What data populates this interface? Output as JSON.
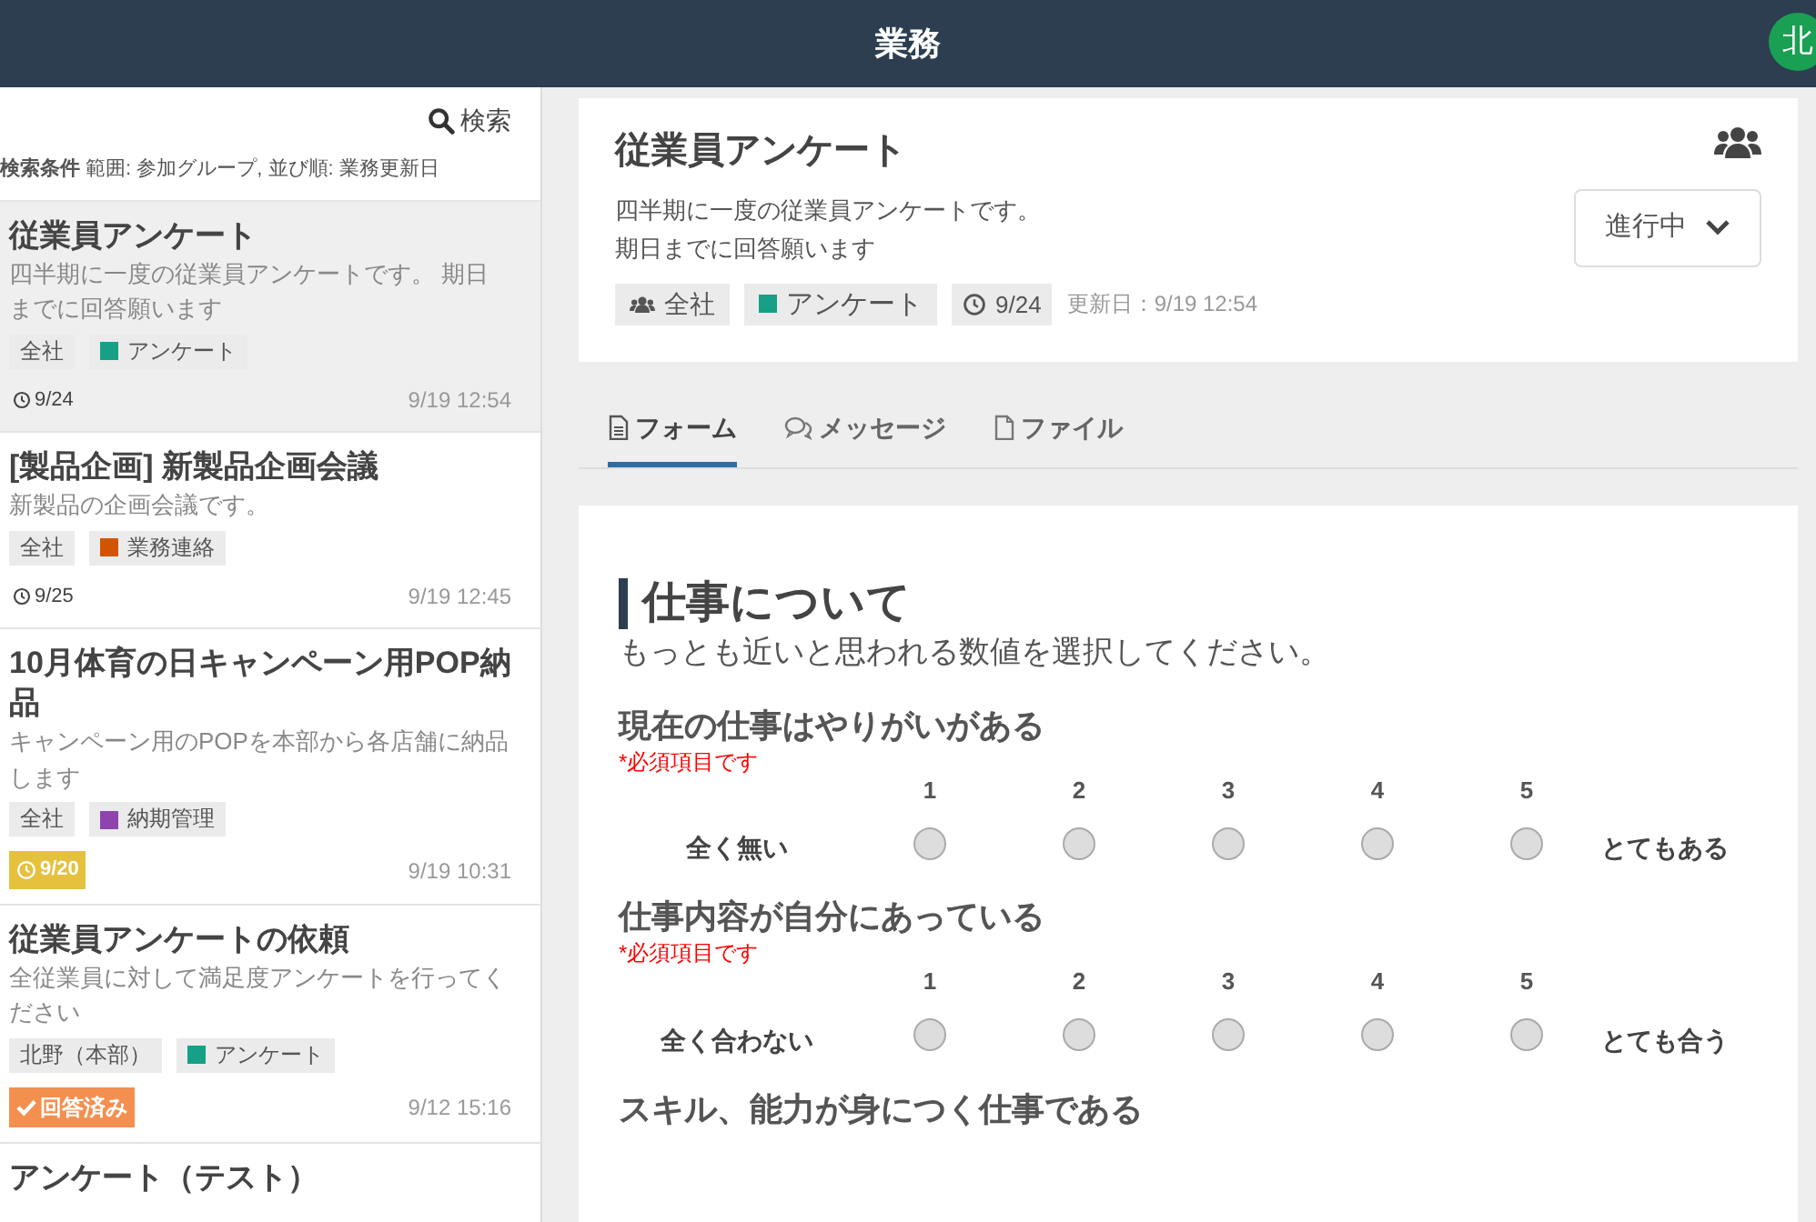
{
  "header": {
    "title": "業務",
    "avatar": "北"
  },
  "sidebar": {
    "search_button": "検索",
    "criteria_label": "検索条件",
    "criteria": "範囲: 参加グループ, 並び順: 業務更新日",
    "items": [
      {
        "title": "従業員アンケート",
        "description": "四半期に一度の従業員アンケートです。 期日までに回答願います",
        "selected": true,
        "tags": [
          {
            "kind": "group",
            "label": "全社"
          },
          {
            "kind": "category",
            "label": "アンケート",
            "color": "#16a085"
          }
        ],
        "status": {
          "kind": "due",
          "label": "9/24"
        },
        "updated": "9/19 12:54"
      },
      {
        "title": "[製品企画] 新製品企画会議",
        "description": "新製品の企画会議です。",
        "selected": false,
        "tags": [
          {
            "kind": "group",
            "label": "全社"
          },
          {
            "kind": "category",
            "label": "業務連絡",
            "color": "#d35400"
          }
        ],
        "status": {
          "kind": "due",
          "label": "9/25"
        },
        "updated": "9/19 12:45"
      },
      {
        "title": "10月体育の日キャンペーン用POP納品",
        "description": "キャンペーン用のPOPを本部から各店舗に納品します",
        "selected": false,
        "tags": [
          {
            "kind": "group",
            "label": "全社"
          },
          {
            "kind": "category",
            "label": "納期管理",
            "color": "#8e44ad"
          }
        ],
        "status": {
          "kind": "due_soon",
          "label": "9/20"
        },
        "updated": "9/19 10:31"
      },
      {
        "title": "従業員アンケートの依頼",
        "description": "全従業員に対して満足度アンケートを行ってください",
        "selected": false,
        "tags": [
          {
            "kind": "group",
            "label": "北野（本部）"
          },
          {
            "kind": "category",
            "label": "アンケート",
            "color": "#16a085"
          }
        ],
        "status": {
          "kind": "answered",
          "label": "回答済み"
        },
        "updated": "9/12 15:16"
      },
      {
        "title": "アンケート（テスト）",
        "selected": false
      }
    ]
  },
  "detail": {
    "title": "従業員アンケート",
    "description_lines": [
      "四半期に一度の従業員アンケートです。",
      "期日までに回答願います"
    ],
    "status_button": "進行中",
    "tags": [
      {
        "kind": "group",
        "label": "全社"
      },
      {
        "kind": "category",
        "label": "アンケート",
        "color": "#16a085"
      },
      {
        "kind": "due",
        "label": "9/24"
      }
    ],
    "updated": "更新日：9/19 12:54"
  },
  "tabs": [
    {
      "label": "フォーム",
      "kind": "form",
      "selected": true
    },
    {
      "label": "メッセージ",
      "kind": "message",
      "selected": false
    },
    {
      "label": "ファイル",
      "kind": "file",
      "selected": false
    }
  ],
  "form": {
    "section_title": "仕事について",
    "section_subtitle": "もっとも近いと思われる数値を選択してください。",
    "questions": [
      {
        "title": "現在の仕事はやりがいがある",
        "required_note": "*必須項目です",
        "low_label": "全く無い",
        "high_label": "とてもある",
        "options": [
          {
            "label": "1",
            "checked": false
          },
          {
            "label": "2",
            "checked": false
          },
          {
            "label": "3",
            "checked": false
          },
          {
            "label": "4",
            "checked": false
          },
          {
            "label": "5",
            "checked": false
          }
        ]
      },
      {
        "title": "仕事内容が自分にあっている",
        "required_note": "*必須項目です",
        "low_label": "全く合わない",
        "high_label": "とても合う",
        "options": [
          {
            "label": "1",
            "checked": false
          },
          {
            "label": "2",
            "checked": false
          },
          {
            "label": "3",
            "checked": false
          },
          {
            "label": "4",
            "checked": false
          },
          {
            "label": "5",
            "checked": false
          }
        ]
      },
      {
        "title": "スキル、能力が身につく仕事である"
      }
    ]
  }
}
